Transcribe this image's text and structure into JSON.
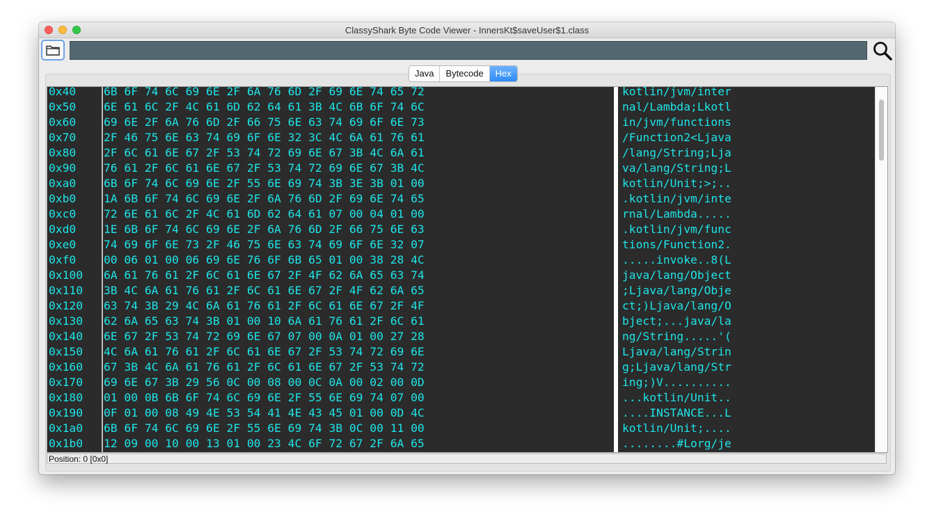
{
  "window": {
    "title": "ClassyShark Byte Code Viewer - InnersKt$saveUser$1.class"
  },
  "toolbar": {
    "search_value": ""
  },
  "tabs": [
    {
      "label": "Java"
    },
    {
      "label": "Bytecode"
    },
    {
      "label": "Hex",
      "active": true
    }
  ],
  "hex": {
    "rows": [
      {
        "addr": "0x40",
        "bytes": "6B 6F 74 6C 69 6E 2F 6A 76 6D 2F 69 6E 74 65 72",
        "ascii": "kotlin/jvm/inter"
      },
      {
        "addr": "0x50",
        "bytes": "6E 61 6C 2F 4C 61 6D 62 64 61 3B 4C 6B 6F 74 6C",
        "ascii": "nal/Lambda;Lkotl"
      },
      {
        "addr": "0x60",
        "bytes": "69 6E 2F 6A 76 6D 2F 66 75 6E 63 74 69 6F 6E 73",
        "ascii": "in/jvm/functions"
      },
      {
        "addr": "0x70",
        "bytes": "2F 46 75 6E 63 74 69 6F 6E 32 3C 4C 6A 61 76 61",
        "ascii": "/Function2<Ljava"
      },
      {
        "addr": "0x80",
        "bytes": "2F 6C 61 6E 67 2F 53 74 72 69 6E 67 3B 4C 6A 61",
        "ascii": "/lang/String;Lja"
      },
      {
        "addr": "0x90",
        "bytes": "76 61 2F 6C 61 6E 67 2F 53 74 72 69 6E 67 3B 4C",
        "ascii": "va/lang/String;L"
      },
      {
        "addr": "0xa0",
        "bytes": "6B 6F 74 6C 69 6E 2F 55 6E 69 74 3B 3E 3B 01 00",
        "ascii": "kotlin/Unit;>;.."
      },
      {
        "addr": "0xb0",
        "bytes": "1A 6B 6F 74 6C 69 6E 2F 6A 76 6D 2F 69 6E 74 65",
        "ascii": ".kotlin/jvm/inte"
      },
      {
        "addr": "0xc0",
        "bytes": "72 6E 61 6C 2F 4C 61 6D 62 64 61 07 00 04 01 00",
        "ascii": "rnal/Lambda....."
      },
      {
        "addr": "0xd0",
        "bytes": "1E 6B 6F 74 6C 69 6E 2F 6A 76 6D 2F 66 75 6E 63",
        "ascii": ".kotlin/jvm/func"
      },
      {
        "addr": "0xe0",
        "bytes": "74 69 6F 6E 73 2F 46 75 6E 63 74 69 6F 6E 32 07",
        "ascii": "tions/Function2."
      },
      {
        "addr": "0xf0",
        "bytes": "00 06 01 00 06 69 6E 76 6F 6B 65 01 00 38 28 4C",
        "ascii": ".....invoke..8(L"
      },
      {
        "addr": "0x100",
        "bytes": "6A 61 76 61 2F 6C 61 6E 67 2F 4F 62 6A 65 63 74",
        "ascii": "java/lang/Object"
      },
      {
        "addr": "0x110",
        "bytes": "3B 4C 6A 61 76 61 2F 6C 61 6E 67 2F 4F 62 6A 65",
        "ascii": ";Ljava/lang/Obje"
      },
      {
        "addr": "0x120",
        "bytes": "63 74 3B 29 4C 6A 61 76 61 2F 6C 61 6E 67 2F 4F",
        "ascii": "ct;)Ljava/lang/O"
      },
      {
        "addr": "0x130",
        "bytes": "62 6A 65 63 74 3B 01 00 10 6A 61 76 61 2F 6C 61",
        "ascii": "bject;...java/la"
      },
      {
        "addr": "0x140",
        "bytes": "6E 67 2F 53 74 72 69 6E 67 07 00 0A 01 00 27 28",
        "ascii": "ng/String.....'("
      },
      {
        "addr": "0x150",
        "bytes": "4C 6A 61 76 61 2F 6C 61 6E 67 2F 53 74 72 69 6E",
        "ascii": "Ljava/lang/Strin"
      },
      {
        "addr": "0x160",
        "bytes": "67 3B 4C 6A 61 76 61 2F 6C 61 6E 67 2F 53 74 72",
        "ascii": "g;Ljava/lang/Str"
      },
      {
        "addr": "0x170",
        "bytes": "69 6E 67 3B 29 56 0C 00 08 00 0C 0A 00 02 00 0D",
        "ascii": "ing;)V.........."
      },
      {
        "addr": "0x180",
        "bytes": "01 00 0B 6B 6F 74 6C 69 6E 2F 55 6E 69 74 07 00",
        "ascii": "...kotlin/Unit.."
      },
      {
        "addr": "0x190",
        "bytes": "0F 01 00 08 49 4E 53 54 41 4E 43 45 01 00 0D 4C",
        "ascii": "....INSTANCE...L"
      },
      {
        "addr": "0x1a0",
        "bytes": "6B 6F 74 6C 69 6E 2F 55 6E 69 74 3B 0C 00 11 00",
        "ascii": "kotlin/Unit;...."
      },
      {
        "addr": "0x1b0",
        "bytes": "12 09 00 10 00 13 01 00 23 4C 6F 72 67 2F 6A 65",
        "ascii": "........#Lorg/je"
      }
    ]
  },
  "status": {
    "position_text": "Position: 0 [0x0]"
  }
}
